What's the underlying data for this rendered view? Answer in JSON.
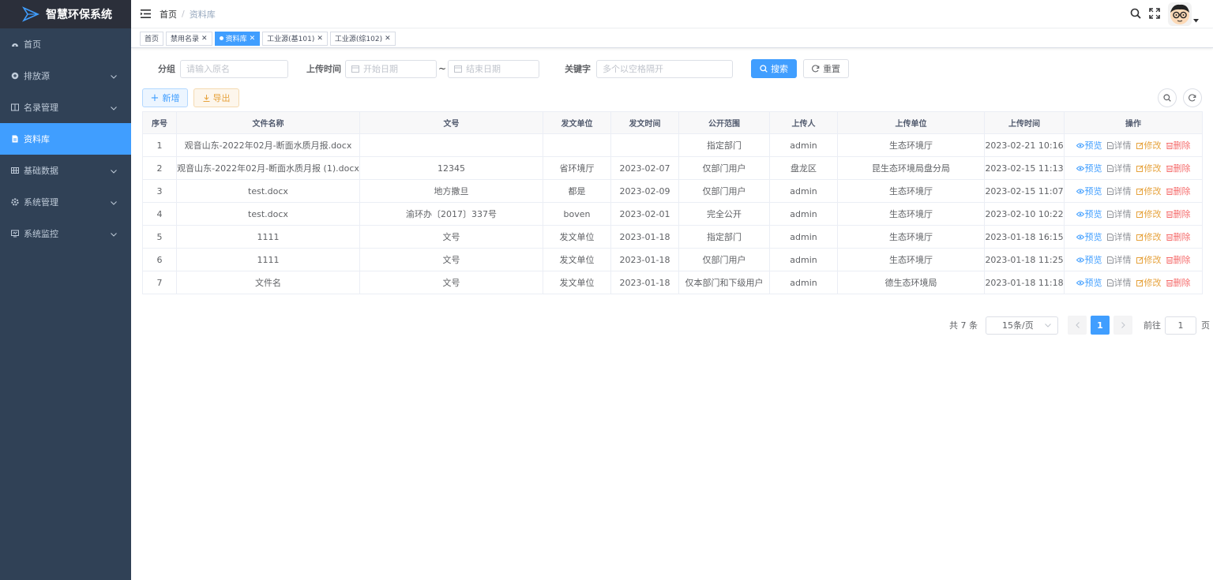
{
  "app": {
    "title": "智慧环保系统"
  },
  "sidebar": {
    "items": [
      {
        "label": "首页",
        "icon": "dashboard-icon",
        "has_children": false,
        "active": false
      },
      {
        "label": "排放源",
        "icon": "source-icon",
        "has_children": true,
        "active": false
      },
      {
        "label": "名录管理",
        "icon": "book-icon",
        "has_children": true,
        "active": false
      },
      {
        "label": "资料库",
        "icon": "document-icon",
        "has_children": false,
        "active": true
      },
      {
        "label": "基础数据",
        "icon": "grid-icon",
        "has_children": true,
        "active": false
      },
      {
        "label": "系统管理",
        "icon": "gear-icon",
        "has_children": true,
        "active": false
      },
      {
        "label": "系统监控",
        "icon": "monitor-icon",
        "has_children": true,
        "active": false
      }
    ]
  },
  "header": {
    "breadcrumb": {
      "home": "首页",
      "separator": "/",
      "current": "资料库"
    }
  },
  "tags": [
    {
      "label": "首页",
      "closable": false,
      "active": false
    },
    {
      "label": "禁用名录",
      "closable": true,
      "active": false
    },
    {
      "label": "资料库",
      "closable": true,
      "active": true
    },
    {
      "label": "工业源(基101)",
      "closable": true,
      "active": false
    },
    {
      "label": "工业源(综102)",
      "closable": true,
      "active": false
    }
  ],
  "search": {
    "group_label": "分组",
    "group_placeholder": "请输入原名",
    "upload_time_label": "上传时间",
    "start_placeholder": "开始日期",
    "range_sep": "~",
    "end_placeholder": "结束日期",
    "keyword_label": "关键字",
    "keyword_placeholder": "多个以空格隔开",
    "search_btn": "搜索",
    "reset_btn": "重置"
  },
  "toolbar": {
    "add_btn": "新增",
    "export_btn": "导出"
  },
  "table": {
    "columns": [
      "序号",
      "文件名称",
      "文号",
      "发文单位",
      "发文时间",
      "公开范围",
      "上传人",
      "上传单位",
      "上传时间",
      "操作"
    ],
    "rows": [
      [
        "1",
        "观音山东-2022年02月-断面水质月报.docx",
        "",
        "",
        "",
        "指定部门",
        "admin",
        "生态环境厅",
        "2023-02-21 10:16"
      ],
      [
        "2",
        "观音山东-2022年02月-断面水质月报 (1).docx",
        "12345",
        "省环境厅",
        "2023-02-07",
        "仅部门用户",
        "盘龙区",
        "昆生态环境局盘分局",
        "2023-02-15 11:13"
      ],
      [
        "3",
        "test.docx",
        "地方撒旦",
        "都是",
        "2023-02-09",
        "仅部门用户",
        "admin",
        "生态环境厅",
        "2023-02-15 11:07"
      ],
      [
        "4",
        "test.docx",
        "渝环办〔2017〕337号",
        "boven",
        "2023-02-01",
        "完全公开",
        "admin",
        "生态环境厅",
        "2023-02-10 10:22"
      ],
      [
        "5",
        "1111",
        "文号",
        "发文单位",
        "2023-01-18",
        "指定部门",
        "admin",
        "生态环境厅",
        "2023-01-18 16:15"
      ],
      [
        "6",
        "1111",
        "文号",
        "发文单位",
        "2023-01-18",
        "仅部门用户",
        "admin",
        "生态环境厅",
        "2023-01-18 11:25"
      ],
      [
        "7",
        "文件名",
        "文号",
        "发文单位",
        "2023-01-18",
        "仅本部门和下级用户",
        "admin",
        "德生态环境局",
        "2023-01-18 11:18"
      ]
    ],
    "actions": {
      "preview": "预览",
      "detail": "详情",
      "edit": "修改",
      "delete": "删除"
    }
  },
  "pagination": {
    "total_text": "共 7 条",
    "page_size": "15条/页",
    "current_page": "1",
    "goto_label": "前往",
    "goto_value": "1",
    "page_suffix": "页"
  },
  "colors": {
    "primary": "#409eff",
    "sidebar_bg": "#304156",
    "logo_bg": "#2b2f3a",
    "danger": "#f56c6c",
    "warning": "#e6a23c"
  }
}
